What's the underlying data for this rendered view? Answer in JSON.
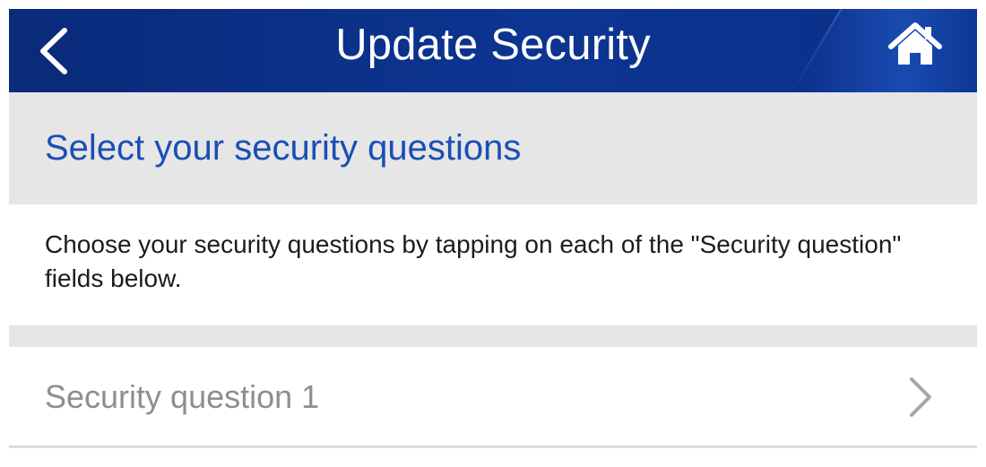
{
  "navbar": {
    "title": "Update Security",
    "back_icon": "chevron-left-icon",
    "home_icon": "home-icon",
    "colors": {
      "background": "#0c3591",
      "text": "#ffffff"
    }
  },
  "section": {
    "title": "Select your security questions",
    "title_color": "#1a4fb4",
    "background": "#e6e6e6"
  },
  "instructions": {
    "text": "Choose your security questions by tapping on each of the \"Security question\" fields below."
  },
  "questions": [
    {
      "placeholder": "Security question 1",
      "icon": "chevron-right-icon"
    }
  ]
}
